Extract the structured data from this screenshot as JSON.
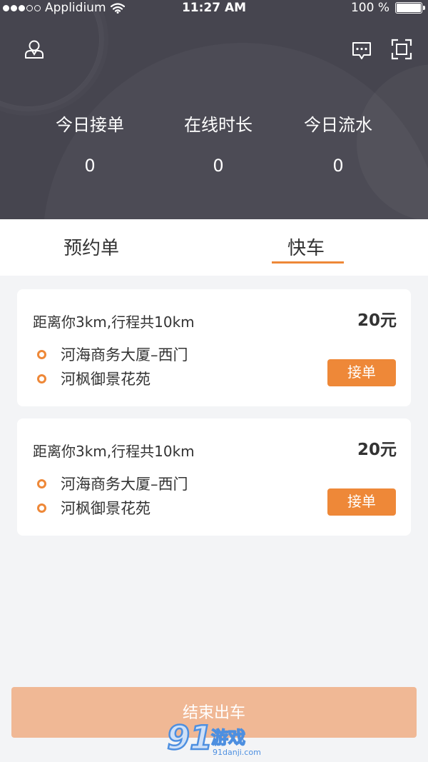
{
  "status_bar": {
    "carrier": "Applidium",
    "time": "11:27 AM",
    "battery": "100 %"
  },
  "header": {
    "icons": [
      "user-icon",
      "message-icon",
      "scan-icon"
    ],
    "stats": [
      {
        "label": "今日接单",
        "value": "0"
      },
      {
        "label": "在线时长",
        "value": "0"
      },
      {
        "label": "今日流水",
        "value": "0"
      }
    ]
  },
  "tabs": {
    "items": [
      "预约单",
      "快车"
    ],
    "active": "快车"
  },
  "orders": [
    {
      "distance": "距离你3km,行程共10km",
      "price": "20元",
      "from": "河海商务大厦–西门",
      "to": "河枫御景花苑",
      "button": "接单"
    },
    {
      "distance": "距离你3km,行程共10km",
      "price": "20元",
      "from": "河海商务大厦–西门",
      "to": "河枫御景花苑",
      "button": "接单"
    }
  ],
  "end_button": "结束出车",
  "watermark": {
    "brand": "91游戏",
    "site": "91danji.com"
  },
  "colors": {
    "accent": "#ee8838",
    "header_bg": "#46454f",
    "end_button_bg": "#f0b895",
    "page_bg": "#f3f4f6"
  }
}
